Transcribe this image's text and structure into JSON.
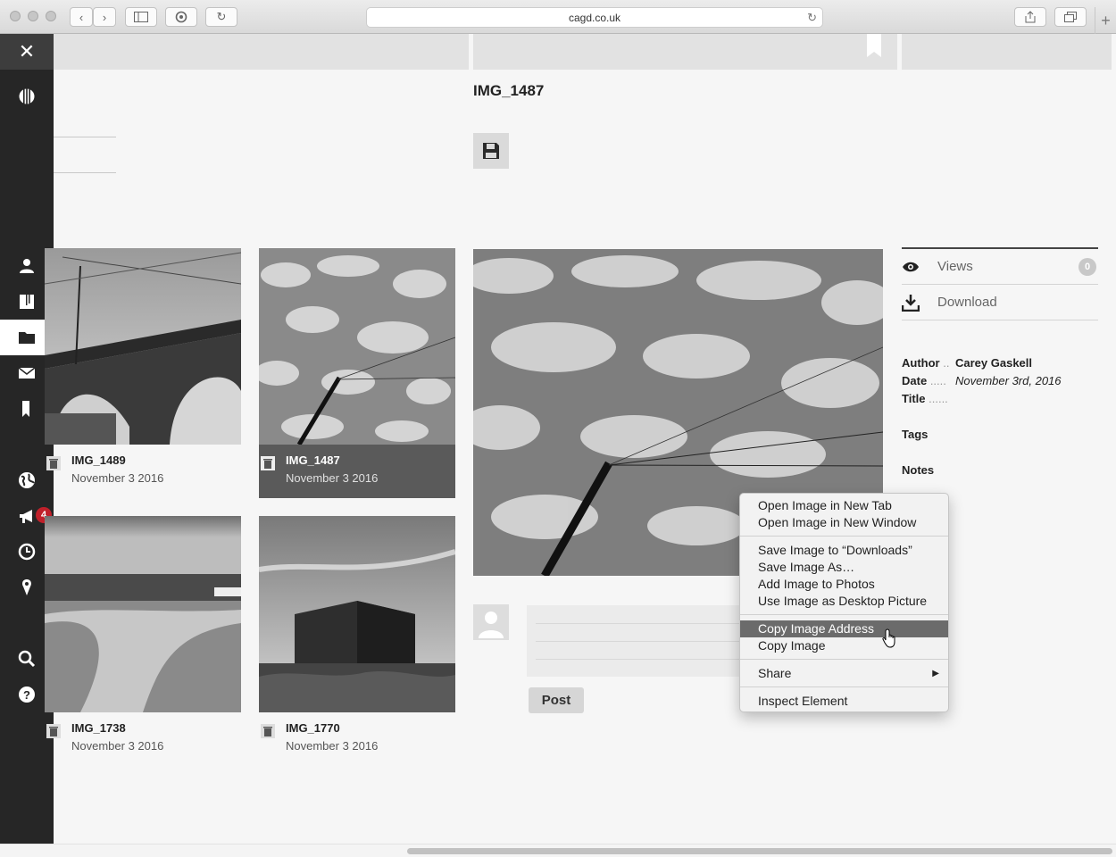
{
  "browser": {
    "url": "cagd.co.uk"
  },
  "sidebar": {
    "items": [
      {
        "name": "close-icon"
      },
      {
        "name": "globe-stripes-icon"
      },
      {
        "name": "user-icon"
      },
      {
        "name": "book-icon"
      },
      {
        "name": "folder-icon",
        "active": true
      },
      {
        "name": "mail-icon"
      },
      {
        "name": "bookmark-icon"
      },
      {
        "name": "world-icon"
      },
      {
        "name": "megaphone-icon",
        "badge": "4"
      },
      {
        "name": "clock-icon"
      },
      {
        "name": "location-pin-icon"
      },
      {
        "name": "search-icon"
      },
      {
        "name": "help-icon"
      }
    ]
  },
  "page": {
    "title": "IMG_1487"
  },
  "thumbnails": [
    {
      "name": "IMG_1489",
      "date": "November 3 2016"
    },
    {
      "name": "IMG_1487",
      "date": "November 3 2016",
      "selected": true
    },
    {
      "name": "IMG_1738",
      "date": "November 3 2016"
    },
    {
      "name": "IMG_1770",
      "date": "November 3 2016"
    }
  ],
  "details": {
    "views_label": "Views",
    "views_count": "0",
    "download_label": "Download",
    "author_key": "Author",
    "author_dots": "..",
    "author_value": "Carey Gaskell",
    "date_key": "Date",
    "date_dots": ".....",
    "date_value": "November 3rd, 2016",
    "title_key": "Title",
    "title_dots": "......",
    "tags_key": "Tags",
    "notes_key": "Notes"
  },
  "comment": {
    "post_label": "Post"
  },
  "context_menu": {
    "open_new_tab": "Open Image in New Tab",
    "open_new_window": "Open Image in New Window",
    "save_downloads": "Save Image to “Downloads”",
    "save_as": "Save Image As…",
    "add_photos": "Add Image to Photos",
    "desktop_picture": "Use Image as Desktop Picture",
    "copy_address": "Copy Image Address",
    "copy_image": "Copy Image",
    "share": "Share",
    "inspect": "Inspect Element"
  },
  "colors": {
    "sidebar_bg": "#262626",
    "badge": "#c0202a",
    "selected_caption": "#5a5a5a",
    "menu_highlight": "#6b6b6b"
  }
}
